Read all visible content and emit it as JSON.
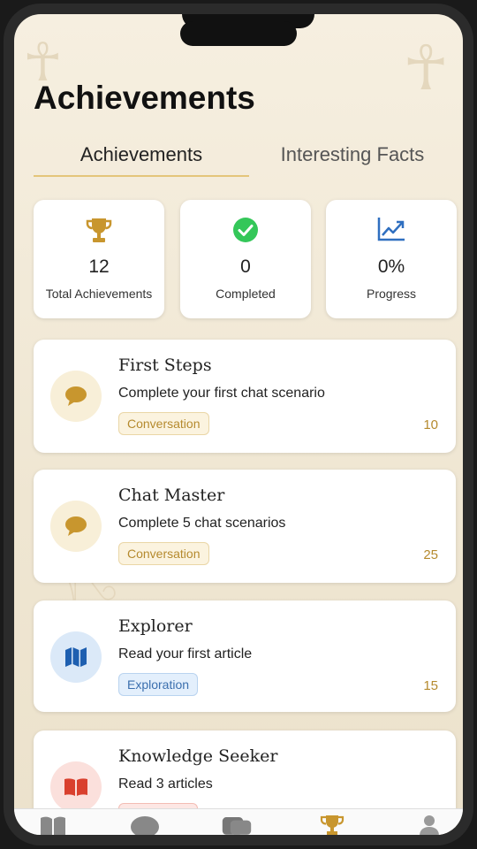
{
  "page": {
    "title": "Achievements"
  },
  "tabs": [
    {
      "label": "Achievements",
      "active": true
    },
    {
      "label": "Interesting Facts",
      "active": false
    }
  ],
  "stats": [
    {
      "icon": "trophy-icon",
      "value": "12",
      "label": "Total Achievements"
    },
    {
      "icon": "check-circle-icon",
      "value": "0",
      "label": "Completed"
    },
    {
      "icon": "trending-up-icon",
      "value": "0%",
      "label": "Progress"
    }
  ],
  "achievements": [
    {
      "icon": "chat-bubble-icon",
      "title": "First Steps",
      "description": "Complete your first chat scenario",
      "category": "Conversation",
      "points": "10"
    },
    {
      "icon": "chat-bubble-icon",
      "title": "Chat Master",
      "description": "Complete 5 chat scenarios",
      "category": "Conversation",
      "points": "25"
    },
    {
      "icon": "map-icon",
      "title": "Explorer",
      "description": "Read your first article",
      "category": "Exploration",
      "points": "15"
    },
    {
      "icon": "book-icon",
      "title": "Knowledge Seeker",
      "description": "Read 3 articles",
      "category": "",
      "points": ""
    }
  ],
  "tab_bar": [
    {
      "icon": "book-icon",
      "active": false
    },
    {
      "icon": "chat-bubble-icon",
      "active": false
    },
    {
      "icon": "cards-icon",
      "active": false
    },
    {
      "icon": "trophy-icon",
      "active": true
    },
    {
      "icon": "person-icon",
      "active": false
    }
  ],
  "colors": {
    "accent_gold": "#c8962e",
    "success_green": "#34c759",
    "progress_blue": "#2f6fc0",
    "explore_blue": "#1e5fb0",
    "knowledge_red": "#d9402e",
    "background": "#f3ecdc"
  }
}
